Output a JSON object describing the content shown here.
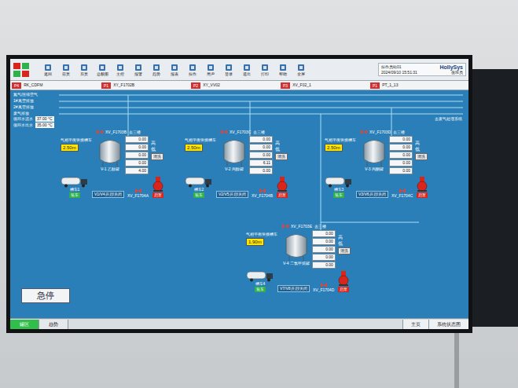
{
  "toolbar": {
    "buttons": [
      "返回",
      "前页",
      "后页",
      "总貌图",
      "主控",
      "报警",
      "趋势",
      "报表",
      "操作",
      "用户",
      "登录",
      "退出",
      "打印",
      "帮助",
      "全屏"
    ],
    "info": {
      "station": "操作员站01",
      "user": "值班员",
      "date": "2024/09/10 15:51:31",
      "brand": "HollySys"
    }
  },
  "alarms": [
    {
      "code": "P4",
      "text": "RK_CDFM",
      "color": "#d32f2f"
    },
    {
      "code": "P1",
      "text": "XY_F1702B",
      "color": "#d32f2f"
    },
    {
      "code": "P2",
      "text": "XY_VV02",
      "color": "#d32f2f"
    },
    {
      "code": "P3",
      "text": "XV_F02_1",
      "color": "#d32f2f"
    },
    {
      "code": "P1",
      "text": "PT_1_13",
      "color": "#d32f2f"
    }
  ],
  "pipes": [
    "氮气/压缩空气",
    "1#真空排放",
    "2#真空排放",
    "废气排放"
  ],
  "water": [
    {
      "label": "循环水进水",
      "value": "37.00 °C"
    },
    {
      "label": "循环水出水",
      "value": "35.00 °C"
    }
  ],
  "exhaust": "去废气处理系统",
  "tanks": [
    {
      "name": "V-1 乙醇罐",
      "tag_top": "XV_F1703B",
      "vent": "去三楼",
      "gas": "气相平衡管接槽车",
      "level": "2.50m",
      "readings": [
        "0.00",
        "0.00",
        "0.00",
        "0.00",
        "4.00"
      ],
      "limits": [
        "高",
        "低"
      ],
      "clean": "清洗",
      "valve": "XV_F1704A",
      "pump": {
        "label": "启泵",
        "running": false
      },
      "truck": {
        "label": "槽车1",
        "button": "装车"
      },
      "switch": "V1/V4开启/关闭"
    },
    {
      "name": "V-2 丙醇罐",
      "tag_top": "XV_F1703C",
      "vent": "去三楼",
      "gas": "气相平衡管接槽车",
      "level": "2.50m",
      "readings": [
        "0.00",
        "0.00",
        "0.00",
        "6.11",
        "0.00"
      ],
      "limits": [
        "高",
        "低"
      ],
      "clean": "清洗",
      "valve": "XV_F1704B",
      "pump": {
        "label": "启泵",
        "running": false
      },
      "truck": {
        "label": "槽车2",
        "button": "装车"
      },
      "switch": "V2/V5开启/关闭"
    },
    {
      "name": "V-3 丙酮罐",
      "tag_top": "XV_F1703D",
      "vent": "去三楼",
      "gas": "气相平衡管接槽车",
      "level": "2.50m",
      "readings": [
        "0.00",
        "0.00",
        "0.00",
        "0.00",
        "0.00"
      ],
      "limits": [
        "高",
        "低"
      ],
      "clean": "清洗",
      "valve": "XV_F1704C",
      "pump": {
        "label": "启泵",
        "running": false
      },
      "truck": {
        "label": "槽车3",
        "button": "装车"
      },
      "switch": "V3/V6开启/关闭"
    },
    {
      "name": "V-4 二氯甲烷罐",
      "tag_top": "XV_F1703E",
      "vent": "去三楼",
      "gas": "气相平衡管接槽车",
      "level": "1.90m",
      "readings": [
        "0.00",
        "0.00",
        "0.00",
        "0.00",
        "0.00"
      ],
      "limits": [
        "高",
        "低"
      ],
      "clean": "清洗",
      "valve": "XV_F1704D",
      "pump": {
        "label": "启泵",
        "running": false
      },
      "truck": {
        "label": "槽车4",
        "button": "装车"
      },
      "switch": "V7/V8开启/关闭"
    }
  ],
  "estop": "急停",
  "tabs": [
    {
      "label": "罐区",
      "selected": true
    },
    {
      "label": "趋势",
      "selected": false
    }
  ],
  "nav": [
    "主页",
    "系统状态图"
  ]
}
